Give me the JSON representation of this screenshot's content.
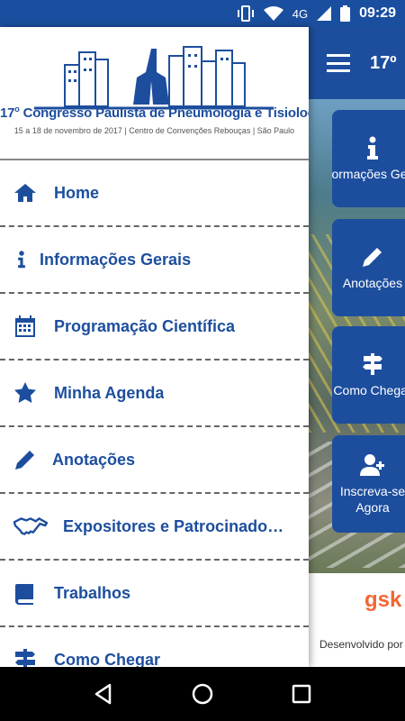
{
  "status_bar": {
    "network": "4G",
    "time": "09:29"
  },
  "app_bar": {
    "title": "17º"
  },
  "tiles": [
    {
      "label": "Informações Gerais",
      "icon": "info-icon"
    },
    {
      "label": "Anotações",
      "icon": "pencil-icon"
    },
    {
      "label": "Como Chegar",
      "icon": "signpost-icon"
    },
    {
      "label": "Inscreva-se Agora",
      "icon": "add-user-icon"
    }
  ],
  "sponsor": {
    "logo_text": "gsk"
  },
  "developer_text": "Desenvolvido por",
  "drawer": {
    "title_prefix": "17",
    "title_sup": "o",
    "title": " Congresso Paulista de Pneumologia e Tisiologia",
    "subtitle": "15 a 18 de novembro de 2017 | Centro de Convenções Rebouças | São Paulo",
    "menu": [
      {
        "label": "Home",
        "icon": "home-icon"
      },
      {
        "label": "Informações Gerais",
        "icon": "info-icon"
      },
      {
        "label": "Programação Científica",
        "icon": "calendar-icon"
      },
      {
        "label": "Minha Agenda",
        "icon": "star-icon"
      },
      {
        "label": "Anotações",
        "icon": "pencil-icon"
      },
      {
        "label": "Expositores e Patrocinadores",
        "icon": "handshake-icon"
      },
      {
        "label": "Trabalhos",
        "icon": "book-icon"
      },
      {
        "label": "Como Chegar",
        "icon": "signpost-icon"
      }
    ]
  },
  "colors": {
    "primary": "#1d4e9e",
    "status_bar": "#1a4fa0",
    "gsk": "#f36633"
  }
}
